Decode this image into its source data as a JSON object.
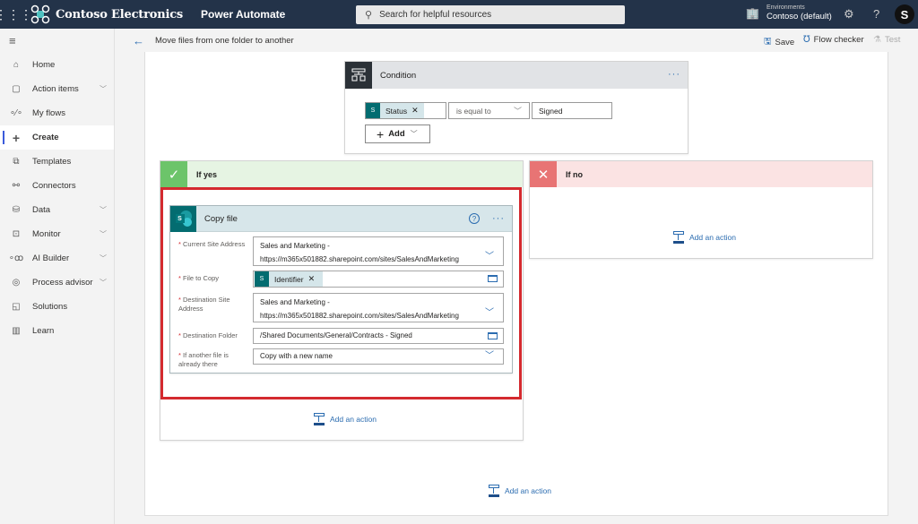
{
  "topbar": {
    "brand": "Contoso Electronics",
    "app": "Power Automate",
    "search_placeholder": "Search for helpful resources",
    "env_label": "Environments",
    "env_value": "Contoso (default)",
    "avatar_initial": "S"
  },
  "sidebar": {
    "items": [
      {
        "label": "Home",
        "icon": "home-icon",
        "chevron": false
      },
      {
        "label": "Action items",
        "icon": "clipboard-icon",
        "chevron": true
      },
      {
        "label": "My flows",
        "icon": "flows-icon",
        "chevron": false
      },
      {
        "label": "Create",
        "icon": "plus-icon",
        "chevron": false,
        "active": true
      },
      {
        "label": "Templates",
        "icon": "templates-icon",
        "chevron": false
      },
      {
        "label": "Connectors",
        "icon": "connectors-icon",
        "chevron": false
      },
      {
        "label": "Data",
        "icon": "database-icon",
        "chevron": true
      },
      {
        "label": "Monitor",
        "icon": "monitor-icon",
        "chevron": true
      },
      {
        "label": "AI Builder",
        "icon": "ai-builder-icon",
        "chevron": true
      },
      {
        "label": "Process advisor",
        "icon": "process-advisor-icon",
        "chevron": true
      },
      {
        "label": "Solutions",
        "icon": "solutions-icon",
        "chevron": false
      },
      {
        "label": "Learn",
        "icon": "book-icon",
        "chevron": false
      }
    ]
  },
  "cmdbar": {
    "flow_title": "Move files from one folder to another",
    "save": "Save",
    "flow_checker": "Flow checker",
    "test": "Test"
  },
  "condition": {
    "title": "Condition",
    "left_token": "Status",
    "operator": "is equal to",
    "right_value": "Signed",
    "add_label": "Add"
  },
  "branches": {
    "yes_label": "If yes",
    "no_label": "If no",
    "add_action": "Add an action"
  },
  "copy_file": {
    "title": "Copy file",
    "fields": {
      "current_site_label": "Current Site Address",
      "current_site_line1": "Sales and Marketing -",
      "current_site_line2": "https://m365x501882.sharepoint.com/sites/SalesAndMarketing",
      "file_to_copy_label": "File to Copy",
      "file_to_copy_token": "Identifier",
      "dest_site_label": "Destination Site Address",
      "dest_site_line1": "Sales and Marketing -",
      "dest_site_line2": "https://m365x501882.sharepoint.com/sites/SalesAndMarketing",
      "dest_folder_label": "Destination Folder",
      "dest_folder_value": "/Shared Documents/General/Contracts - Signed",
      "conflict_label": "If another file is already there",
      "conflict_value": "Copy with a new name"
    }
  },
  "colors": {
    "topbar": "#233349",
    "accent": "#2b6cb0",
    "yes": "#5cb85c",
    "no": "#e57373",
    "highlight": "#d42a2f"
  }
}
